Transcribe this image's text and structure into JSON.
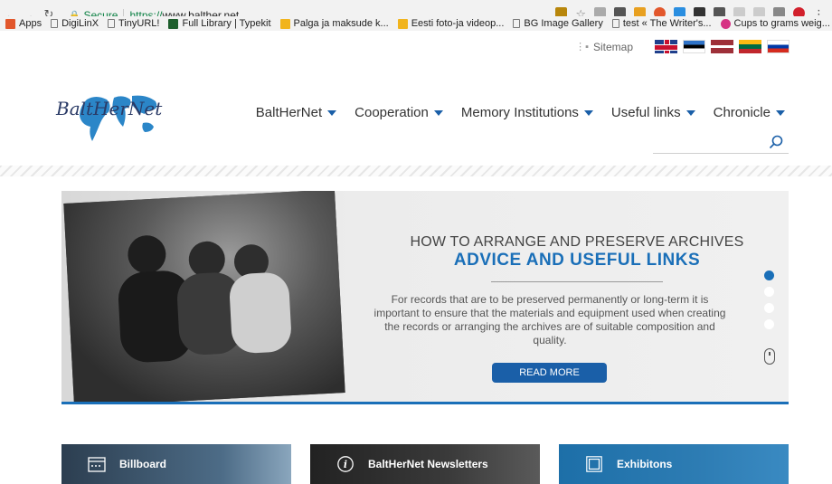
{
  "browser": {
    "secure_label": "Secure",
    "url_proto": "https://",
    "url_host": "www.balther.net",
    "bookmarks": [
      {
        "label": "Apps",
        "icon": "apps-grid-icon"
      },
      {
        "label": "DigiLinX",
        "icon": "page-icon"
      },
      {
        "label": "TinyURL!",
        "icon": "page-icon"
      },
      {
        "label": "Full Library | Typekit",
        "icon": "typekit-icon"
      },
      {
        "label": "Palga ja maksude k...",
        "icon": "palga-icon"
      },
      {
        "label": "Eesti foto-ja videop...",
        "icon": "eesti-foto-icon"
      },
      {
        "label": "BG Image Gallery",
        "icon": "page-icon"
      },
      {
        "label": "test « The Writer's...",
        "icon": "page-icon"
      },
      {
        "label": "Cups to grams weig...",
        "icon": "cups-icon"
      }
    ]
  },
  "header": {
    "sitemap_label": "Sitemap",
    "logo_text": "BaltHerNet",
    "nav": [
      {
        "label": "BaltHerNet"
      },
      {
        "label": "Cooperation"
      },
      {
        "label": "Memory Institutions"
      },
      {
        "label": "Useful links"
      },
      {
        "label": "Chronicle"
      }
    ],
    "flags": [
      "uk-flag",
      "estonia-flag",
      "latvia-flag",
      "lithuania-flag",
      "russia-flag"
    ]
  },
  "hero": {
    "title_line1": "HOW TO ARRANGE AND PRESERVE ARCHIVES",
    "title_line2": "ADVICE AND USEFUL LINKS",
    "body": "For records that are to be preserved permanently or long-term it is important to ensure that the materials and equipment used when creating the records or arranging the archives are of suitable composition and quality.",
    "button_label": "READ MORE",
    "slide_count": 4,
    "active_slide": 1,
    "accent_color": "#1a6fb8"
  },
  "cards": [
    {
      "label": "Billboard",
      "icon": "billboard-icon"
    },
    {
      "label": "BaltHerNet Newsletters",
      "icon": "info-icon"
    },
    {
      "label": "Exhibitons",
      "icon": "exhibitions-icon"
    }
  ]
}
